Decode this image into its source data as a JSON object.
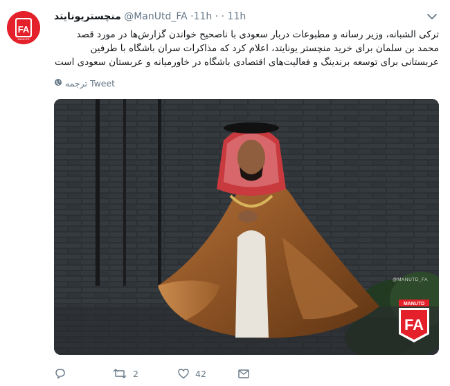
{
  "tweet": {
    "display_name": "منچستریونایتد",
    "handle": "@ManUtd_FA",
    "time_1": "11h",
    "time_2": "11h",
    "separator": "·",
    "separator_2": "·",
    "text": "ترکی الشبانه، وزیر رسانه و مطبوعات دربار سعودی با ناصحیح خواندن گزارش‌ها در مورد قصد محمد بن سلمان برای خرید منچستر یونایتد، اعلام کرد که مذاکرات سران باشگاه با طرفین عربستانی برای توسعه برندینگ و فعالیت‌های اقتصادی باشگاه در خاورمیانه و عربستان سعودی است",
    "translate_label": "ترجمه Tweet",
    "watermark_handle": "@MANUTD_FA",
    "watermark_brand": "MANUTD",
    "watermark_letters": "FA",
    "avatar_brand": "MANUTD",
    "avatar_letters": "FA"
  },
  "actions": {
    "reply_count": "",
    "retweet_count": "2",
    "like_count": "42"
  },
  "colors": {
    "brand_red": "#e4202a",
    "meta_gray": "#657786"
  },
  "icons": [
    "caret-down-icon",
    "globe-icon",
    "reply-icon",
    "retweet-icon",
    "like-icon",
    "direct-message-icon"
  ]
}
